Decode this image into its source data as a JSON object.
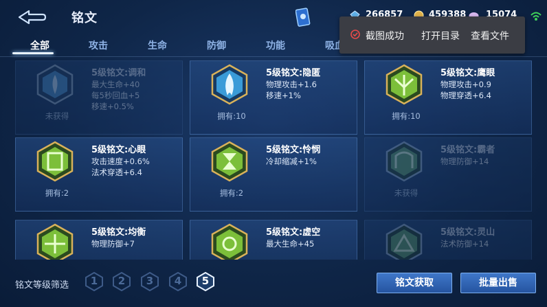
{
  "header": {
    "title": "铭文",
    "currencies": [
      {
        "icon": "diamond-icon",
        "value": "266857",
        "color": "#5fb0e8"
      },
      {
        "icon": "gold-coin-icon",
        "value": "459388",
        "color": "#e0b24a"
      },
      {
        "icon": "gem-icon",
        "value": "15074",
        "color": "#d9b8f0"
      }
    ]
  },
  "toast": {
    "message": "截图成功",
    "open_dir": "打开目录",
    "view_file": "查看文件"
  },
  "tabs": [
    {
      "label": "全部",
      "active": true
    },
    {
      "label": "攻击"
    },
    {
      "label": "生命"
    },
    {
      "label": "防御"
    },
    {
      "label": "功能"
    },
    {
      "label": "吸血"
    }
  ],
  "cards": [
    {
      "name": "5级铭文:调和",
      "attrs": [
        "最大生命+40",
        "每5秒回血+5",
        "移速+0.5%"
      ],
      "count": "未获得",
      "owned": false,
      "color": "#4a8fd0"
    },
    {
      "name": "5级铭文:隐匿",
      "attrs": [
        "物理攻击+1.6",
        "移速+1%"
      ],
      "count": "拥有:10",
      "owned": true,
      "color": "#3a9bd8"
    },
    {
      "name": "5级铭文:鹰眼",
      "attrs": [
        "物理攻击+0.9",
        "物理穿透+6.4"
      ],
      "count": "拥有:10",
      "owned": true,
      "color": "#7cbf3a"
    },
    {
      "name": "5级铭文:心眼",
      "attrs": [
        "攻击速度+0.6%",
        "法术穿透+6.4"
      ],
      "count": "拥有:2",
      "owned": true,
      "color": "#7cbf3a"
    },
    {
      "name": "5级铭文:怜悯",
      "attrs": [
        "冷却缩减+1%"
      ],
      "count": "拥有:2",
      "owned": true,
      "color": "#7cbf3a"
    },
    {
      "name": "5级铭文:霸者",
      "attrs": [
        "物理防御+14"
      ],
      "count": "未获得",
      "owned": false,
      "color": "#5a9a6a"
    },
    {
      "name": "5级铭文:均衡",
      "attrs": [
        "物理防御+7"
      ],
      "count": "",
      "owned": true,
      "color": "#7cbf3a"
    },
    {
      "name": "5级铭文:虚空",
      "attrs": [
        "最大生命+45"
      ],
      "count": "",
      "owned": true,
      "color": "#7cbf3a"
    },
    {
      "name": "5级铭文:灵山",
      "attrs": [
        "法术防御+14"
      ],
      "count": "",
      "owned": false,
      "color": "#5a9a6a"
    }
  ],
  "footer": {
    "filter_label": "铭文等级筛选",
    "levels": [
      "1",
      "2",
      "3",
      "4",
      "5"
    ],
    "active_level": "5",
    "obtain_button": "铭文获取",
    "sell_button": "批量出售"
  }
}
